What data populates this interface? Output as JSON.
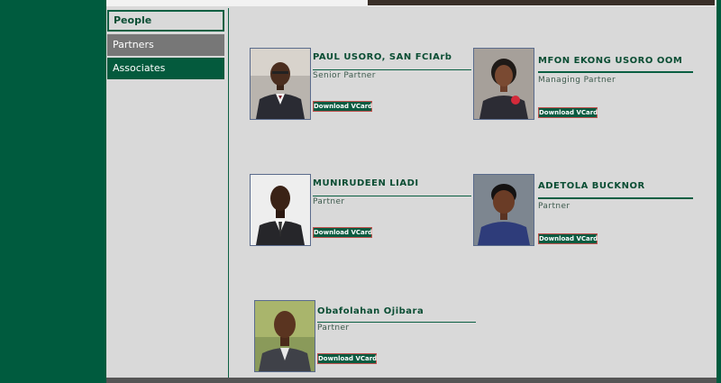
{
  "sidebar": {
    "items": [
      {
        "label": "People"
      },
      {
        "label": "Partners"
      },
      {
        "label": "Associates"
      }
    ]
  },
  "people": [
    {
      "name": "PAUL USORO, SAN FCIArb",
      "role": "Senior Partner",
      "vcard_label": "Download VCard"
    },
    {
      "name": "MFON EKONG USORO OOM",
      "role": "Managing Partner",
      "vcard_label": "Download VCard"
    },
    {
      "name": "MUNIRUDEEN LIADI",
      "role": "Partner",
      "vcard_label": "Download VCard"
    },
    {
      "name": "ADETOLA BUCKNOR",
      "role": "Partner",
      "vcard_label": "Download VCard"
    },
    {
      "name": "Obafolahan Ojibara",
      "role": "Partner",
      "vcard_label": "Download VCard"
    }
  ],
  "colors": {
    "brand_green": "#005b3e",
    "content_bg": "#d9d9d9",
    "active_nav": "#777777",
    "vcard_border": "#c0504d"
  }
}
